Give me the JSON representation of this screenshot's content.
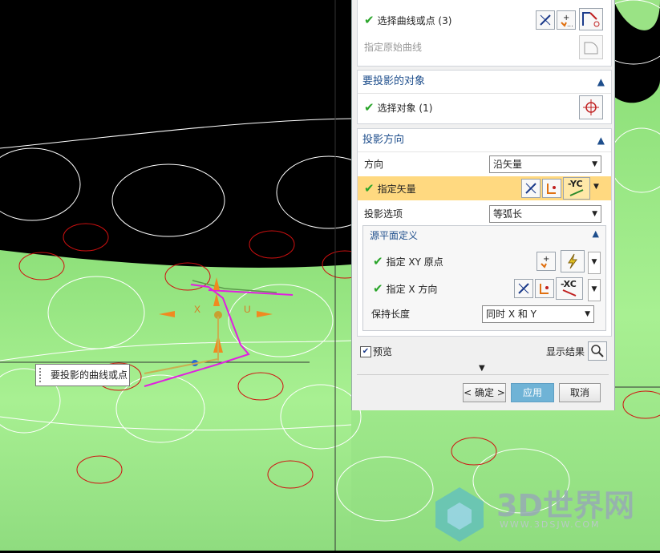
{
  "curves_section": {
    "select_label": "选择曲线或点 (3)",
    "original_label": "指定原始曲线"
  },
  "target_section": {
    "title": "要投影的对象",
    "select_label": "选择对象 (1)"
  },
  "direction_section": {
    "title": "投影方向",
    "direction_label": "方向",
    "direction_value": "沿矢量",
    "vector_label": "指定矢量",
    "vector_icon_text": "-YC",
    "option_label": "投影选项",
    "option_value": "等弧长",
    "sub_title": "源平面定义",
    "xy_origin_label": "指定 XY 原点",
    "x_dir_label": "指定 X 方向",
    "x_icon_text": "-XC",
    "keep_len_label": "保持长度",
    "keep_len_value": "同时 X 和 Y"
  },
  "preview": {
    "label": "预览",
    "show_result": "显示结果",
    "checked": true
  },
  "buttons": {
    "ok": "< 确定 >",
    "apply": "应用",
    "cancel": "取消"
  },
  "tooltip": "要投影的曲线或点",
  "viewport": {
    "axis_x": "X",
    "axis_u": "U"
  },
  "watermark": {
    "title": "3D世界网",
    "url": "WWW.3DSJW.COM"
  },
  "colors": {
    "accent": "#1e4e8c",
    "highlight_row": "#ffd980",
    "apply_button": "#6fb3d6",
    "check": "#2aa52a",
    "surface_green": "#9de88a"
  }
}
